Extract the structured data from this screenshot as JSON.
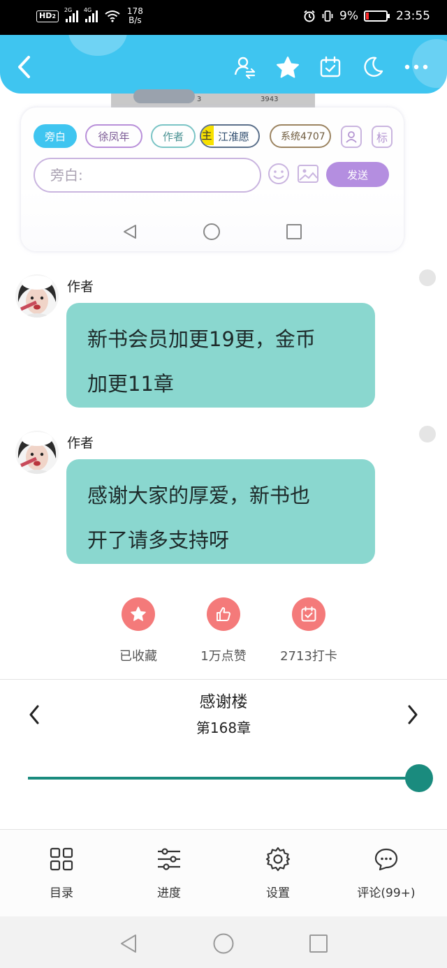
{
  "status_bar": {
    "network_type": "HD",
    "network_sub": "2",
    "signal1_label": "2G",
    "signal2_label": "4G",
    "speed_value": "178",
    "speed_unit": "B/s",
    "battery_percent": "9%",
    "time": "23:55"
  },
  "top_bar": {
    "icons": [
      "back-chevron-icon",
      "user-swap-icon",
      "star-icon",
      "calendar-check-icon",
      "moon-icon",
      "more-icon"
    ]
  },
  "peek": {
    "number": "3",
    "number2": "3943"
  },
  "composer": {
    "roles": {
      "narration": "旁白",
      "xu": "徐凤年",
      "author": "作者",
      "host_tag": "主",
      "jiang": "江淮愿",
      "system": "系统4707"
    },
    "mark_label": "标",
    "placeholder": "旁白:",
    "send_label": "发送"
  },
  "messages": [
    {
      "sender": "作者",
      "line1": "新书会员加更19更，金币",
      "line2": "加更11章"
    },
    {
      "sender": "作者",
      "line1": "感谢大家的厚爱，新书也",
      "line2": "开了请多支持呀"
    }
  ],
  "actions": {
    "collect": "已收藏",
    "like": "1万点赞",
    "checkin": "2713打卡"
  },
  "chapter": {
    "title": "感谢楼",
    "number": "第168章",
    "progress": 1.0
  },
  "toolbar": {
    "toc": "目录",
    "progress": "进度",
    "settings": "设置",
    "comments": "评论(99+)"
  },
  "colors": {
    "accent_blue": "#3fc5f0",
    "bubble_teal": "#8ad7cf",
    "action_red": "#f47a7a",
    "slider_green": "#1a8b7e",
    "send_purple": "#b48ee0"
  }
}
